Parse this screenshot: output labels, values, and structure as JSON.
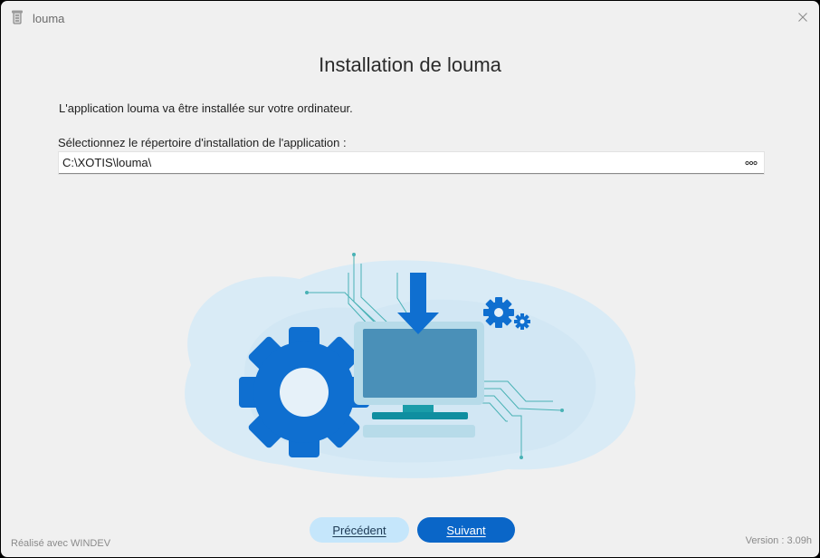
{
  "window": {
    "title": "louma",
    "app_icon": "installer-icon",
    "close_icon": "close-icon"
  },
  "main": {
    "heading": "Installation de louma",
    "intro_text": "L'application louma va être installée sur votre ordinateur.",
    "directory_label": "Sélectionnez le répertoire d'installation de l'application :",
    "directory_value": "C:\\XOTIS\\louma\\",
    "browse_icon": "more-options-icon",
    "illustration": "computer-download-gears-illustration"
  },
  "buttons": {
    "previous_label": "Précédent",
    "next_label": "Suivant"
  },
  "footer": {
    "made_with": "Réalisé avec WINDEV",
    "version": "Version : 3.09h"
  },
  "colors": {
    "background": "#f0f0f0",
    "accent": "#0a66c8",
    "secondary_button": "#c5e6fb",
    "illustration_blue": "#0f6fd0",
    "illustration_screen": "#4a90b8"
  }
}
